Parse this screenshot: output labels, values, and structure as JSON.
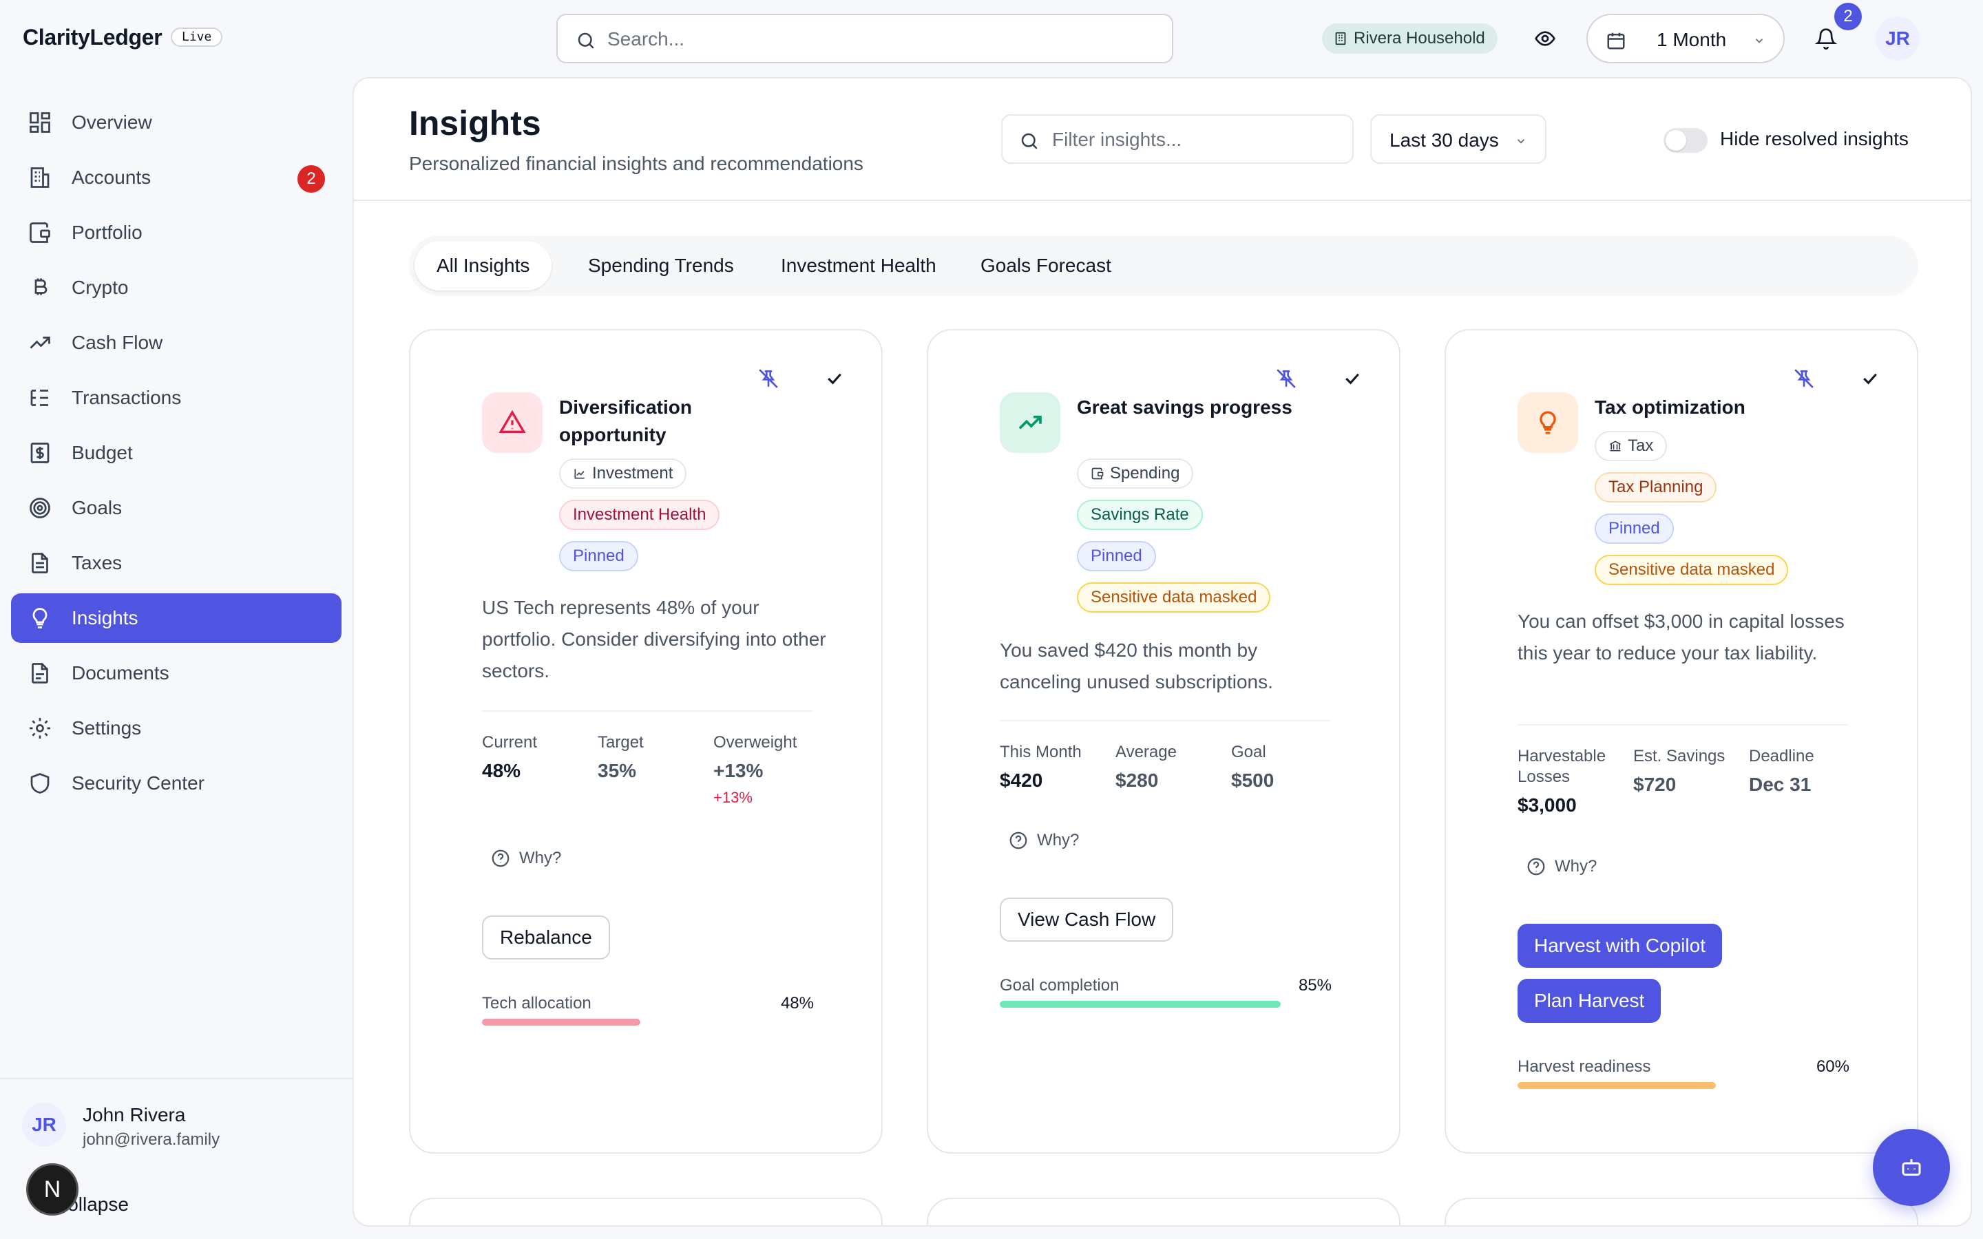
{
  "app": {
    "brand": "ClarityLedger",
    "env_badge": "Live"
  },
  "topbar": {
    "search_placeholder": "Search...",
    "household": "Rivera Household",
    "period": "1 Month",
    "notifications_count": "2",
    "user_initials": "JR"
  },
  "sidebar": {
    "items": [
      {
        "label": "Overview",
        "icon": "grid-icon"
      },
      {
        "label": "Accounts",
        "icon": "building-icon",
        "badge": "2"
      },
      {
        "label": "Portfolio",
        "icon": "wallet-icon"
      },
      {
        "label": "Crypto",
        "icon": "bitcoin-icon"
      },
      {
        "label": "Cash Flow",
        "icon": "trend-icon"
      },
      {
        "label": "Transactions",
        "icon": "list-icon"
      },
      {
        "label": "Budget",
        "icon": "dollar-doc-icon"
      },
      {
        "label": "Goals",
        "icon": "target-icon"
      },
      {
        "label": "Taxes",
        "icon": "document-icon"
      },
      {
        "label": "Insights",
        "icon": "lightbulb-icon",
        "active": true
      },
      {
        "label": "Documents",
        "icon": "file-icon"
      },
      {
        "label": "Settings",
        "icon": "gear-icon"
      },
      {
        "label": "Security Center",
        "icon": "shield-icon"
      }
    ],
    "user": {
      "initials": "JR",
      "name": "John Rivera",
      "email": "john@rivera.family"
    },
    "collapse_label": "Collapse",
    "assistant_bubble": "N"
  },
  "main": {
    "title": "Insights",
    "subtitle": "Personalized financial insights and recommendations",
    "filter_placeholder": "Filter insights...",
    "range": "Last 30 days",
    "hide_resolved_label": "Hide resolved insights",
    "hide_resolved": false,
    "tabs": [
      "All Insights",
      "Spending Trends",
      "Investment Health",
      "Goals Forecast"
    ],
    "active_tab": "All Insights"
  },
  "cards": [
    {
      "title": "Diversification opportunity",
      "icon": "warning-icon",
      "category": "Investment",
      "tags": [
        "Investment Health",
        "Pinned"
      ],
      "description": "US Tech represents 48% of your portfolio. Consider diversifying into other sectors.",
      "metrics": [
        {
          "label": "Current",
          "value": "48%"
        },
        {
          "label": "Target",
          "value": "35%"
        },
        {
          "label": "Overweight",
          "value": "+13%",
          "delta": "+13%"
        }
      ],
      "why_label": "Why?",
      "actions": [
        "Rebalance"
      ],
      "progress": {
        "label": "Tech allocation",
        "value_text": "48%",
        "fraction": 0.48,
        "color": "#f59aa6"
      }
    },
    {
      "title": "Great savings progress",
      "icon": "trend-up-icon",
      "category": "Spending",
      "tags": [
        "Savings Rate",
        "Pinned",
        "Sensitive data masked"
      ],
      "description": "You saved $420 this month by canceling unused subscriptions.",
      "metrics": [
        {
          "label": "This Month",
          "value": "$420"
        },
        {
          "label": "Average",
          "value": "$280"
        },
        {
          "label": "Goal",
          "value": "$500"
        }
      ],
      "why_label": "Why?",
      "actions": [
        "View Cash Flow"
      ],
      "progress": {
        "label": "Goal completion",
        "value_text": "85%",
        "fraction": 0.85,
        "color": "#6ee7b7"
      }
    },
    {
      "title": "Tax optimization",
      "icon": "lightbulb-icon",
      "category": "Tax",
      "tags": [
        "Tax Planning",
        "Pinned",
        "Sensitive data masked"
      ],
      "description": "You can offset $3,000 in capital losses this year to reduce your tax liability.",
      "metrics": [
        {
          "label": "Harvestable Losses",
          "value": "$3,000"
        },
        {
          "label": "Est. Savings",
          "value": "$720"
        },
        {
          "label": "Deadline",
          "value": "Dec 31"
        }
      ],
      "why_label": "Why?",
      "actions": [
        "Harvest with Copilot",
        "Plan Harvest"
      ],
      "progress": {
        "label": "Harvest readiness",
        "value_text": "60%",
        "fraction": 0.6,
        "color": "#fbbf6b"
      }
    }
  ],
  "colors": {
    "accent": "#4f55e0",
    "danger": "#dc2626"
  }
}
